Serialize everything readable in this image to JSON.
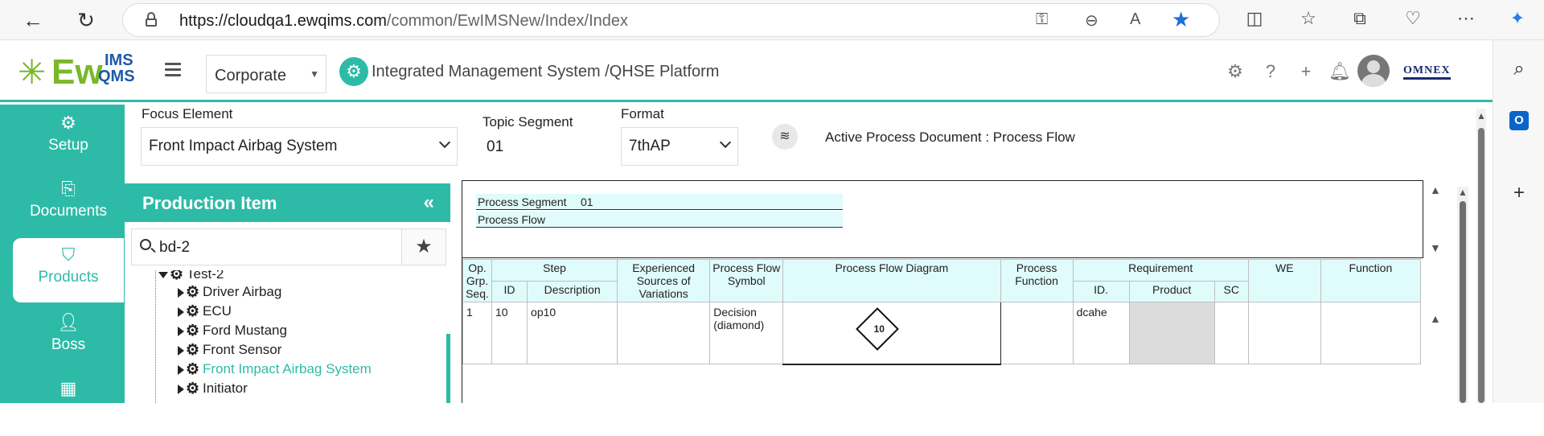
{
  "browser": {
    "url_host": "https://cloudqa1.ewqims.com",
    "url_path": "/common/EwIMSNew/Index/Index"
  },
  "header": {
    "logo_ew": "Ew",
    "logo_ims": "IMS",
    "logo_qms": "QMS",
    "org_select": "Corporate",
    "platform_title": "Integrated Management System /QHSE Platform",
    "brand": "OMNEX"
  },
  "leftnav": {
    "items": [
      {
        "label": "Setup",
        "icon": "gears-icon"
      },
      {
        "label": "Documents",
        "icon": "documents-icon"
      },
      {
        "label": "Products",
        "icon": "products-icon"
      },
      {
        "label": "Boss",
        "icon": "boss-icon"
      }
    ]
  },
  "focus": {
    "focus_label": "Focus Element",
    "focus_value": "Front Impact Airbag System",
    "topic_label": "Topic Segment",
    "topic_value": "01",
    "format_label": "Format",
    "format_value": "7thAP",
    "active_doc": "Active Process Document : Process Flow"
  },
  "production": {
    "title": "Production Item",
    "search_value": "bd-2",
    "tree": [
      {
        "label": "Test-2",
        "selected": false
      },
      {
        "label": "Driver Airbag",
        "selected": false
      },
      {
        "label": "ECU",
        "selected": false
      },
      {
        "label": "Ford Mustang",
        "selected": false
      },
      {
        "label": "Front Sensor",
        "selected": false
      },
      {
        "label": "Front Impact Airbag System",
        "selected": true
      },
      {
        "label": "Initiator",
        "selected": false
      }
    ]
  },
  "segment": {
    "process_segment_label": "Process Segment",
    "process_segment_value": "01",
    "process_flow_label": "Process Flow"
  },
  "table": {
    "headers": {
      "op": "Op. Grp. Seq.",
      "step": "Step",
      "id": "ID",
      "desc": "Description",
      "exp": "Experienced Sources of Variations",
      "symbol": "Process Flow Symbol",
      "diagram": "Process Flow Diagram",
      "function": "Process Function",
      "requirement": "Requirement",
      "req_id": "ID.",
      "product": "Product",
      "sc": "SC",
      "we": "WE",
      "func2": "Function"
    },
    "row": {
      "op": "1",
      "id": "10",
      "desc": "op10",
      "exp": "",
      "symbol": "Decision (diamond)",
      "diagram_num": "10",
      "function": "",
      "req_id": "dcahe",
      "product": "",
      "sc": "",
      "we": "",
      "func2": ""
    }
  }
}
